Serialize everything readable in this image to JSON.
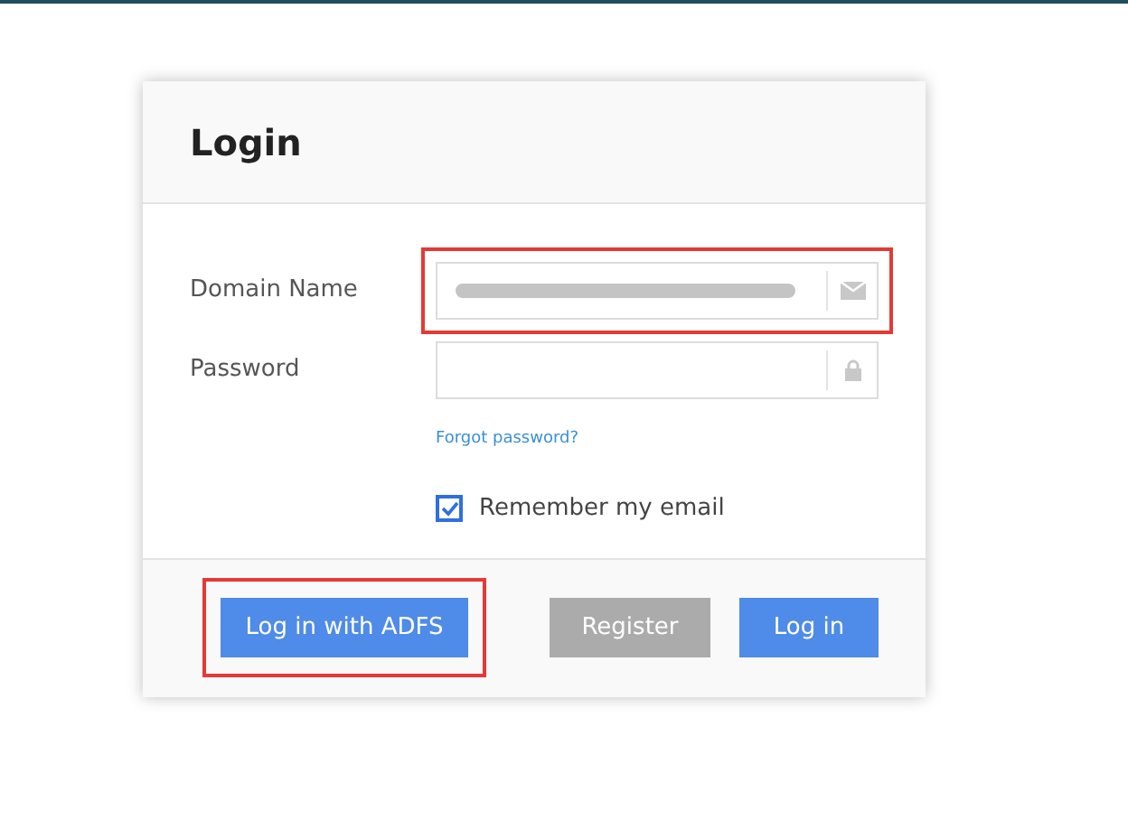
{
  "dialog": {
    "title": "Login"
  },
  "fields": [
    {
      "label": "Domain Name",
      "kind": "email",
      "redacted": true,
      "highlighted": true
    },
    {
      "label": "Password",
      "kind": "password",
      "redacted": false,
      "highlighted": false
    }
  ],
  "forgot_link": "Forgot password?",
  "remember": {
    "label": "Remember my email",
    "checked": true
  },
  "buttons": [
    {
      "label": "Log in with ADFS",
      "disabled": false,
      "highlighted": true
    },
    {
      "label": "Register",
      "disabled": true,
      "highlighted": false
    },
    {
      "label": "Log in",
      "disabled": false,
      "highlighted": false
    }
  ]
}
